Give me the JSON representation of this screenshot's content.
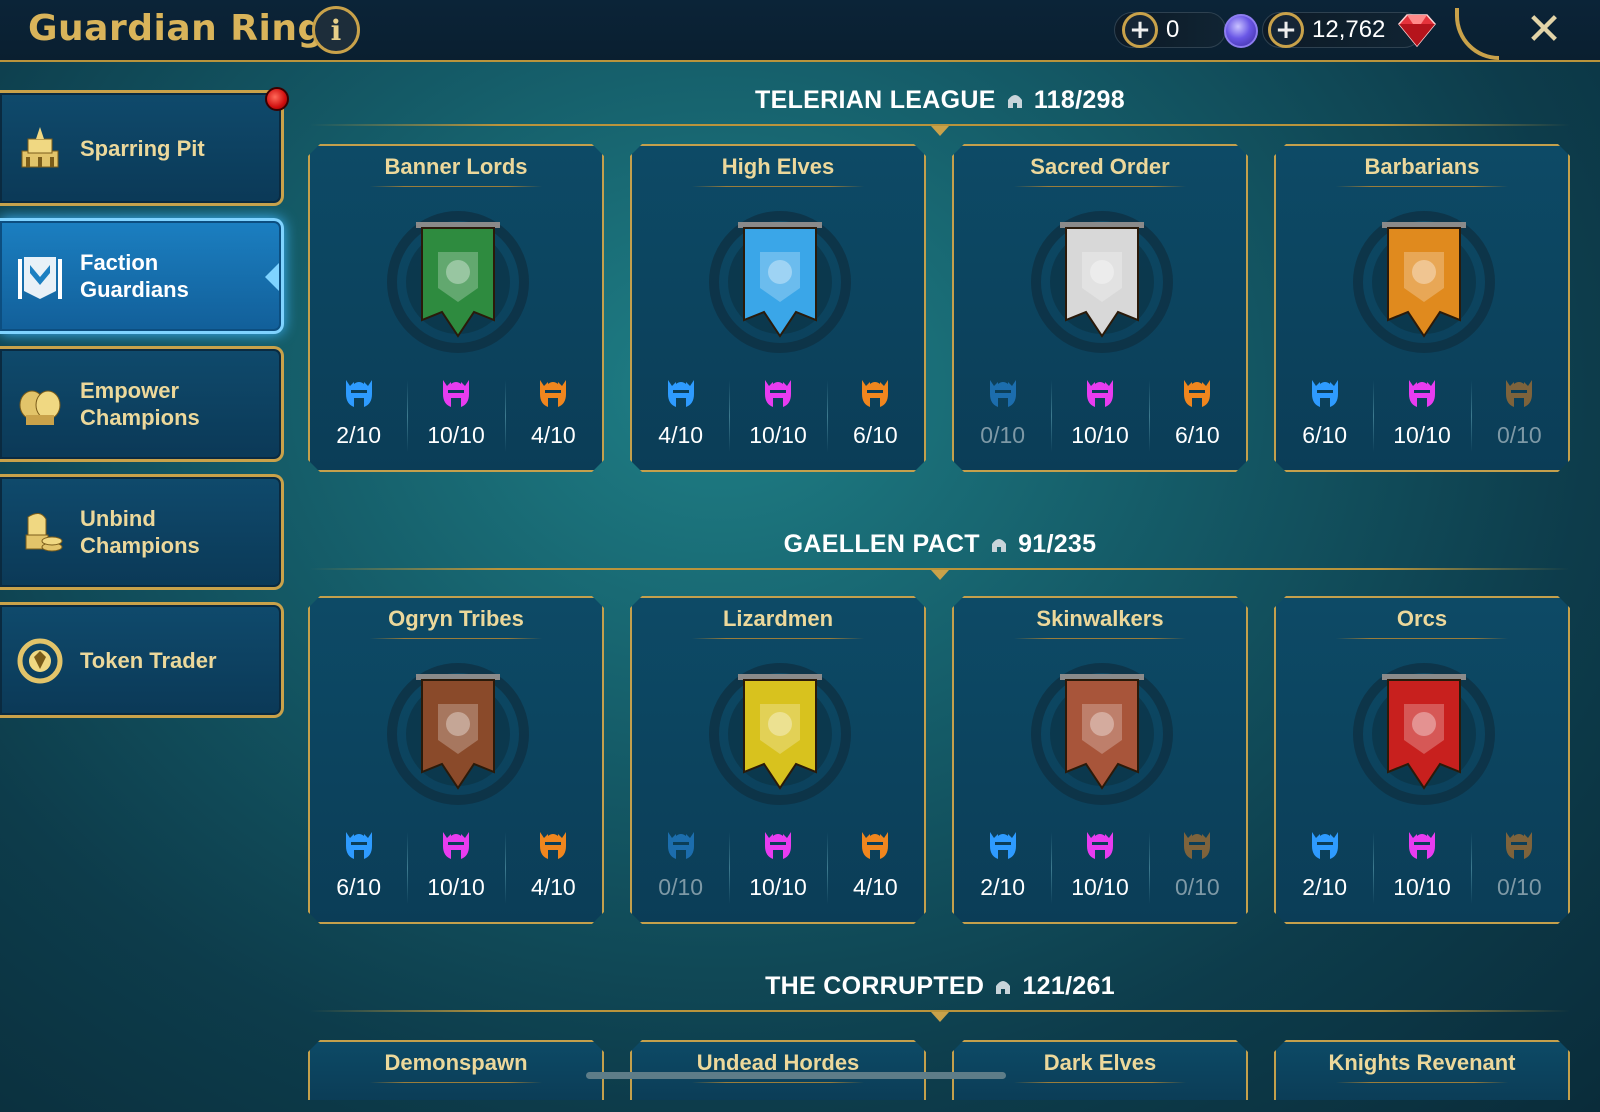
{
  "header": {
    "title": "Guardian Ring",
    "info_label": "i",
    "currency1_value": "0",
    "currency2_value": "12,762",
    "close_label": "✕"
  },
  "sidebar": {
    "items": [
      {
        "label": "Sparring Pit",
        "icon": "arena-icon",
        "active": false,
        "notification": true
      },
      {
        "label": "Faction\nGuardians",
        "icon": "faction-banner-icon",
        "active": true,
        "notification": false
      },
      {
        "label": "Empower\nChampions",
        "icon": "fist-icon",
        "active": false,
        "notification": false
      },
      {
        "label": "Unbind\nChampions",
        "icon": "knight-coins-icon",
        "active": false,
        "notification": false
      },
      {
        "label": "Token Trader",
        "icon": "token-icon",
        "active": false,
        "notification": false
      }
    ]
  },
  "sections": [
    {
      "title": "TELERIAN LEAGUE",
      "count": "118/298",
      "cards": [
        {
          "name": "Banner Lords",
          "stats": [
            "2/10",
            "10/10",
            "4/10"
          ],
          "crest_color": "#2e8b3f"
        },
        {
          "name": "High Elves",
          "stats": [
            "4/10",
            "10/10",
            "6/10"
          ],
          "crest_color": "#3aa6e8"
        },
        {
          "name": "Sacred Order",
          "stats": [
            "0/10",
            "10/10",
            "6/10"
          ],
          "crest_color": "#d8d8d8"
        },
        {
          "name": "Barbarians",
          "stats": [
            "6/10",
            "10/10",
            "0/10"
          ],
          "crest_color": "#e08a1e"
        }
      ]
    },
    {
      "title": "GAELLEN PACT",
      "count": "91/235",
      "cards": [
        {
          "name": "Ogryn Tribes",
          "stats": [
            "6/10",
            "10/10",
            "4/10"
          ],
          "crest_color": "#8a4a2a"
        },
        {
          "name": "Lizardmen",
          "stats": [
            "0/10",
            "10/10",
            "4/10"
          ],
          "crest_color": "#d8c21e"
        },
        {
          "name": "Skinwalkers",
          "stats": [
            "2/10",
            "10/10",
            "0/10"
          ],
          "crest_color": "#a8553a"
        },
        {
          "name": "Orcs",
          "stats": [
            "2/10",
            "10/10",
            "0/10"
          ],
          "crest_color": "#c8201e"
        }
      ]
    },
    {
      "title": "THE CORRUPTED",
      "count": "121/261",
      "cards": [
        {
          "name": "Demonspawn"
        },
        {
          "name": "Undead Hordes"
        },
        {
          "name": "Dark Elves"
        },
        {
          "name": "Knights Revenant"
        }
      ]
    }
  ],
  "colors": {
    "rarity_blue": "#2e9bff",
    "rarity_pink": "#e83cf0",
    "rarity_orange": "#f0861e",
    "gold": "#c9a24a"
  }
}
